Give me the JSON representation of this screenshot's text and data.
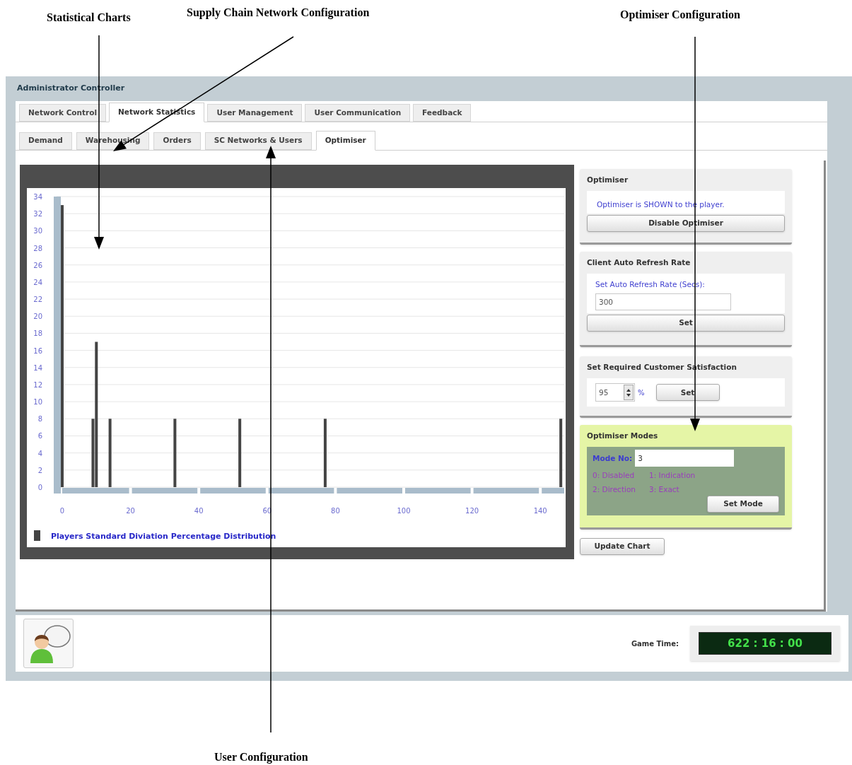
{
  "annotations": [
    {
      "label": "Statistical Charts"
    },
    {
      "label": "Supply Chain Network Configuration"
    },
    {
      "label": "Optimiser Configuration"
    },
    {
      "label": "User Configuration"
    }
  ],
  "window": {
    "title": "Administrator Controller"
  },
  "tabs": [
    {
      "label": "Network Control",
      "selected": false
    },
    {
      "label": "Network Statistics",
      "selected": true
    },
    {
      "label": "User Management",
      "selected": false
    },
    {
      "label": "User Communication",
      "selected": false
    },
    {
      "label": "Feedback",
      "selected": false
    }
  ],
  "subtabs": [
    {
      "label": "Demand",
      "selected": false
    },
    {
      "label": "Warehousing",
      "selected": false
    },
    {
      "label": "Orders",
      "selected": false
    },
    {
      "label": "SC Networks & Users",
      "selected": false
    },
    {
      "label": "Optimiser",
      "selected": true
    }
  ],
  "chart": {
    "chart_data": {
      "type": "bar",
      "x": [
        0,
        9,
        10,
        14,
        33,
        52,
        77,
        146
      ],
      "series": [
        {
          "name": "Players Standard Diviation Percentage Distribution",
          "color": "#444444",
          "values": [
            33,
            8,
            17,
            8,
            8,
            8,
            8,
            8
          ]
        }
      ],
      "xlim": [
        0,
        147
      ],
      "grid": true,
      "ylim": [
        0,
        34
      ],
      "xticks": [
        0,
        20,
        40,
        60,
        80,
        100,
        120,
        140
      ],
      "yticks": [
        0,
        2,
        4,
        6,
        8,
        10,
        12,
        14,
        16,
        18,
        20,
        22,
        24,
        26,
        28,
        30,
        32,
        34
      ]
    }
  },
  "optimiser": {
    "title": "Optimiser",
    "status": "Optimiser is SHOWN to the player.",
    "button": "Disable Optimiser"
  },
  "refresh": {
    "title": "Client Auto Refresh Rate",
    "label": "Set Auto Refresh Rate (Secs):",
    "value": "300",
    "button": "Set"
  },
  "satisfaction": {
    "title": "Set Required Customer Satisfaction",
    "value": "95",
    "unit": "%",
    "button": "Set"
  },
  "modes": {
    "title": "Optimiser Modes",
    "label": "Mode No:",
    "value": "3",
    "options": [
      "0: Disabled",
      "1: Indication",
      "2: Direction",
      "3: Exact"
    ],
    "button": "Set Mode"
  },
  "update_button": "Update Chart",
  "footer": {
    "game_time_label": "Game Time:",
    "game_time": "622 : 16 : 00"
  }
}
